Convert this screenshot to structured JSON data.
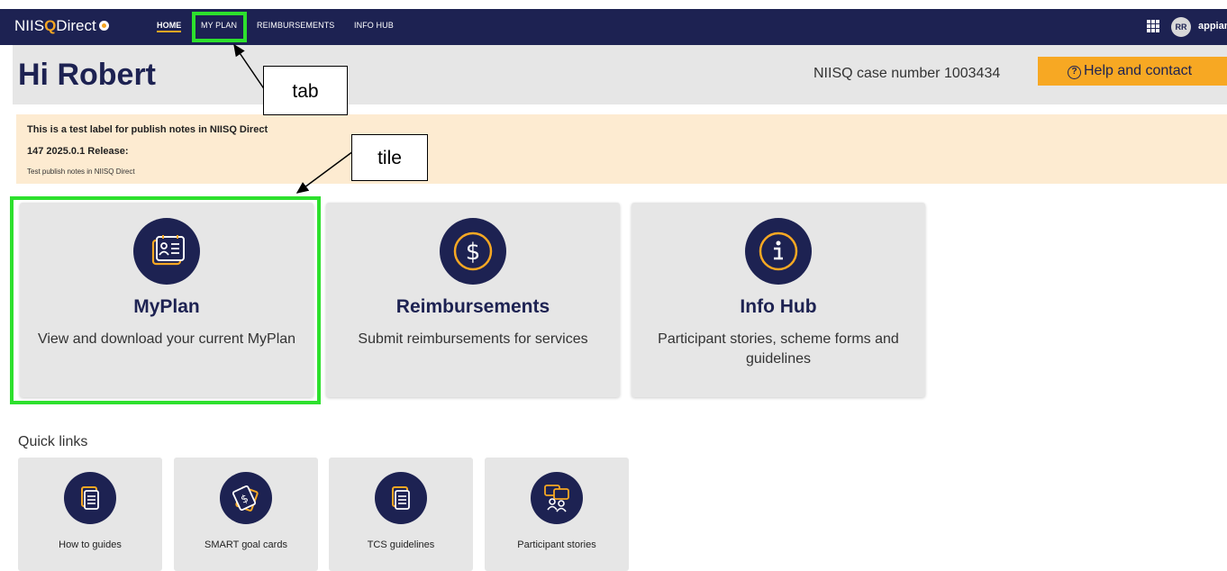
{
  "topbar": {
    "logo_prefix": "NIIS",
    "logo_q": "Q",
    "logo_suffix": "Direct",
    "nav": [
      "HOME",
      "MY PLAN",
      "REIMBURSEMENTS",
      "INFO HUB"
    ],
    "active_nav": "HOME",
    "avatar_initials": "RR",
    "brand": "appian"
  },
  "header": {
    "greeting": "Hi Robert",
    "case_number": "NIISQ case number 1003434",
    "help_button": "Help and contact"
  },
  "banner": {
    "line1": "This is a test label for publish notes in NIISQ Direct",
    "line2": "147 2025.0.1 Release:",
    "line3": "Test publish notes in NIISQ Direct"
  },
  "tiles": [
    {
      "title": "MyPlan",
      "desc": "View and download your current MyPlan",
      "icon": "myplan-icon"
    },
    {
      "title": "Reimbursements",
      "desc": "Submit reimbursements for services",
      "icon": "dollar-icon"
    },
    {
      "title": "Info Hub",
      "desc": "Participant stories, scheme forms and guidelines",
      "icon": "info-icon"
    }
  ],
  "quick_links": {
    "title": "Quick links",
    "items": [
      {
        "label": "How to guides",
        "icon": "document-icon"
      },
      {
        "label": "SMART goal cards",
        "icon": "cards-icon"
      },
      {
        "label": "TCS guidelines",
        "icon": "document-icon"
      },
      {
        "label": "Participant stories",
        "icon": "chat-people-icon"
      }
    ]
  },
  "annotations": {
    "tab_label": "tab",
    "tile_label": "tile",
    "highlight_color": "#2de02d"
  },
  "colors": {
    "navy": "#1d2252",
    "accent_orange": "#f7a823",
    "banner_bg": "#fdebd1"
  }
}
